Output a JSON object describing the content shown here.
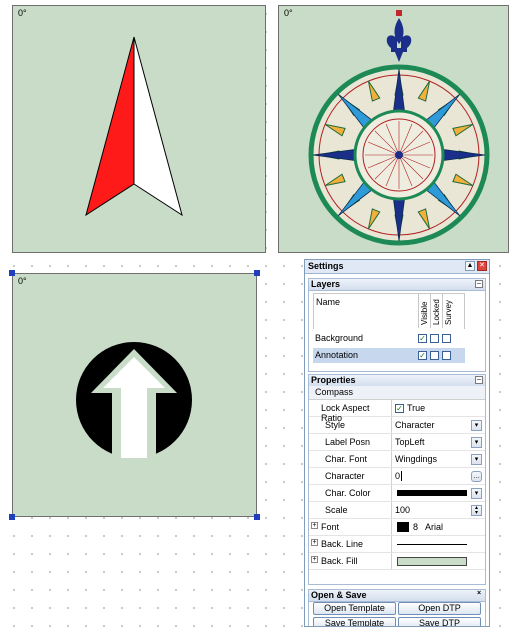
{
  "canvas": {
    "panels": [
      {
        "angle_label": "0°"
      },
      {
        "angle_label": "0°"
      },
      {
        "angle_label": "0°"
      }
    ]
  },
  "settings": {
    "title": "Settings",
    "layers": {
      "header": "Layers",
      "columns": {
        "name": "Name",
        "visible": "Visible",
        "locked": "Locked",
        "survey": "Survey"
      },
      "rows": [
        {
          "name": "Background",
          "visible": true,
          "locked": false,
          "survey": false,
          "selected": false
        },
        {
          "name": "Annotation",
          "visible": true,
          "locked": false,
          "survey": false,
          "selected": true
        }
      ]
    },
    "properties": {
      "header": "Properties",
      "object": "Compass",
      "lock_aspect_ratio": {
        "label": "Lock Aspect Ratio",
        "value": "True"
      },
      "style": {
        "label": "Style",
        "value": "Character"
      },
      "label_posn": {
        "label": "Label Posn",
        "value": "TopLeft"
      },
      "char_font": {
        "label": "Char. Font",
        "value": "Wingdings"
      },
      "character": {
        "label": "Character",
        "value": "0"
      },
      "char_color": {
        "label": "Char. Color",
        "value": "#000000"
      },
      "scale": {
        "label": "Scale",
        "value": "100"
      },
      "font": {
        "label": "Font",
        "size": "8",
        "name": "Arial"
      },
      "back_line": {
        "label": "Back. Line"
      },
      "back_fill": {
        "label": "Back. Fill",
        "value": "#c8dcc8"
      }
    },
    "open_save": {
      "header": "Open & Save",
      "open_template": "Open Template",
      "open_dtp": "Open DTP",
      "save_template": "Save Template",
      "save_dtp": "Save DTP"
    }
  }
}
